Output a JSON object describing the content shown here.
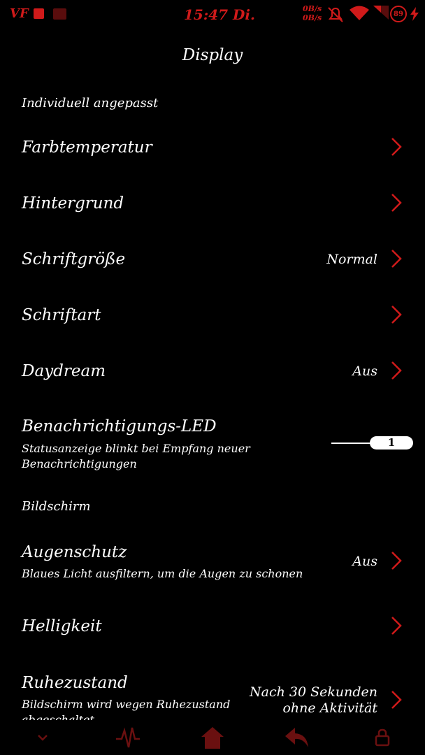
{
  "status_bar": {
    "carrier": "VF",
    "time": "15:47 Di.",
    "net_up": "0B/s",
    "net_down": "0B/s",
    "battery": "89",
    "accent": "#d01a1a"
  },
  "page_title": "Display",
  "sections": {
    "custom": "Individuell angepasst",
    "screen": "Bildschirm"
  },
  "items": {
    "farbtemperatur": {
      "title": "Farbtemperatur"
    },
    "hintergrund": {
      "title": "Hintergrund"
    },
    "schriftgroesse": {
      "title": "Schriftgröße",
      "value": "Normal"
    },
    "schriftart": {
      "title": "Schriftart"
    },
    "daydream": {
      "title": "Daydream",
      "value": "Aus"
    },
    "led": {
      "title": "Benachrichtigungs-LED",
      "subtitle": "Statusanzeige blinkt bei Empfang neuer Benachrichtigungen",
      "toggle_label": "1"
    },
    "augenschutz": {
      "title": "Augenschutz",
      "subtitle": "Blaues Licht ausfiltern, um die Augen zu schonen",
      "value": "Aus"
    },
    "helligkeit": {
      "title": "Helligkeit"
    },
    "ruhezustand": {
      "title": "Ruhezustand",
      "subtitle": "Bildschirm wird wegen Ruhezustand abgeschaltet",
      "value_line1": "Nach 30 Sekunden",
      "value_line2": "ohne Aktivität"
    }
  },
  "nav_icons": [
    "chevron-down-icon",
    "pulse-icon",
    "home-icon",
    "back-icon",
    "lock-icon"
  ]
}
